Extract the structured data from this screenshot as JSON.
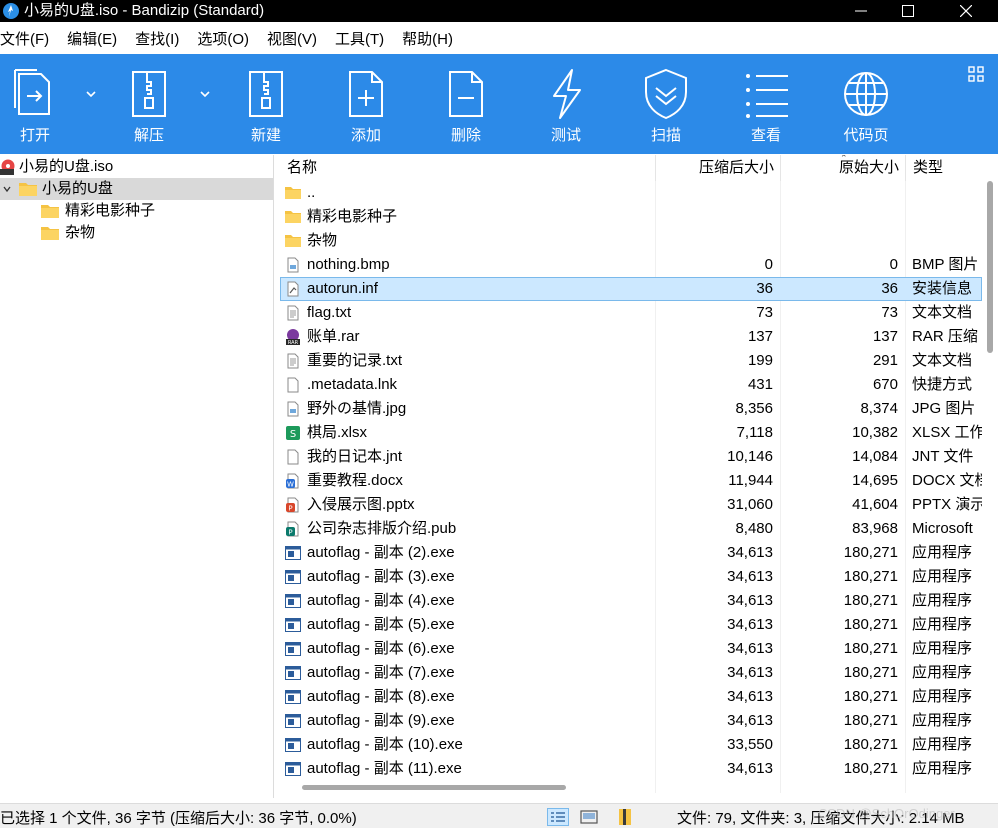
{
  "window": {
    "title": "小易的U盘.iso - Bandizip (Standard)",
    "accent": "#2c8ae8"
  },
  "menu": [
    "文件(F)",
    "编辑(E)",
    "查找(I)",
    "选项(O)",
    "视图(V)",
    "工具(T)",
    "帮助(H)"
  ],
  "toolbar": [
    {
      "label": "打开",
      "icon": "open-icon"
    },
    {
      "label": "解压",
      "icon": "extract-icon"
    },
    {
      "label": "新建",
      "icon": "new-archive-icon"
    },
    {
      "label": "添加",
      "icon": "add-file-icon"
    },
    {
      "label": "删除",
      "icon": "delete-file-icon"
    },
    {
      "label": "测试",
      "icon": "test-lightning-icon"
    },
    {
      "label": "扫描",
      "icon": "scan-shield-icon"
    },
    {
      "label": "查看",
      "icon": "view-list-icon"
    },
    {
      "label": "代码页",
      "icon": "codepage-globe-icon"
    }
  ],
  "tree": {
    "root": "小易的U盘.iso",
    "folder": "小易的U盘",
    "children": [
      "精彩电影种子",
      "杂物"
    ]
  },
  "columns": {
    "name": "名称",
    "compressed": "压缩后大小",
    "original": "原始大小",
    "type": "类型"
  },
  "files": [
    {
      "name": "..",
      "comp": "",
      "orig": "",
      "type": "",
      "icon": "folder"
    },
    {
      "name": "精彩电影种子",
      "comp": "",
      "orig": "",
      "type": "",
      "icon": "folder"
    },
    {
      "name": "杂物",
      "comp": "",
      "orig": "",
      "type": "",
      "icon": "folder"
    },
    {
      "name": "nothing.bmp",
      "comp": "0",
      "orig": "0",
      "type": "BMP 图片",
      "icon": "image"
    },
    {
      "name": "autorun.inf",
      "comp": "36",
      "orig": "36",
      "type": "安装信息",
      "icon": "inf"
    },
    {
      "name": "flag.txt",
      "comp": "73",
      "orig": "73",
      "type": "文本文档",
      "icon": "text"
    },
    {
      "name": "账单.rar",
      "comp": "137",
      "orig": "137",
      "type": "RAR 压缩",
      "icon": "rar"
    },
    {
      "name": "重要的记录.txt",
      "comp": "199",
      "orig": "291",
      "type": "文本文档",
      "icon": "text"
    },
    {
      "name": ".metadata.lnk",
      "comp": "431",
      "orig": "670",
      "type": "快捷方式",
      "icon": "blank"
    },
    {
      "name": "野外の基情.jpg",
      "comp": "8,356",
      "orig": "8,374",
      "type": "JPG 图片",
      "icon": "image"
    },
    {
      "name": "棋局.xlsx",
      "comp": "7,118",
      "orig": "10,382",
      "type": "XLSX 工作",
      "icon": "xlsx"
    },
    {
      "name": "我的日记本.jnt",
      "comp": "10,146",
      "orig": "14,084",
      "type": "JNT 文件",
      "icon": "blank"
    },
    {
      "name": "重要教程.docx",
      "comp": "11,944",
      "orig": "14,695",
      "type": "DOCX 文档",
      "icon": "docx"
    },
    {
      "name": "入侵展示图.pptx",
      "comp": "31,060",
      "orig": "41,604",
      "type": "PPTX 演示",
      "icon": "pptx"
    },
    {
      "name": "公司杂志排版介绍.pub",
      "comp": "8,480",
      "orig": "83,968",
      "type": "Microsoft",
      "icon": "pub"
    },
    {
      "name": "autoflag - 副本 (2).exe",
      "comp": "34,613",
      "orig": "180,271",
      "type": "应用程序",
      "icon": "exe"
    },
    {
      "name": "autoflag - 副本 (3).exe",
      "comp": "34,613",
      "orig": "180,271",
      "type": "应用程序",
      "icon": "exe"
    },
    {
      "name": "autoflag - 副本 (4).exe",
      "comp": "34,613",
      "orig": "180,271",
      "type": "应用程序",
      "icon": "exe"
    },
    {
      "name": "autoflag - 副本 (5).exe",
      "comp": "34,613",
      "orig": "180,271",
      "type": "应用程序",
      "icon": "exe"
    },
    {
      "name": "autoflag - 副本 (6).exe",
      "comp": "34,613",
      "orig": "180,271",
      "type": "应用程序",
      "icon": "exe"
    },
    {
      "name": "autoflag - 副本 (7).exe",
      "comp": "34,613",
      "orig": "180,271",
      "type": "应用程序",
      "icon": "exe"
    },
    {
      "name": "autoflag - 副本 (8).exe",
      "comp": "34,613",
      "orig": "180,271",
      "type": "应用程序",
      "icon": "exe"
    },
    {
      "name": "autoflag - 副本 (9).exe",
      "comp": "34,613",
      "orig": "180,271",
      "type": "应用程序",
      "icon": "exe"
    },
    {
      "name": "autoflag - 副本 (10).exe",
      "comp": "33,550",
      "orig": "180,271",
      "type": "应用程序",
      "icon": "exe"
    },
    {
      "name": "autoflag - 副本 (11).exe",
      "comp": "34,613",
      "orig": "180,271",
      "type": "应用程序",
      "icon": "exe"
    }
  ],
  "selected_row": 4,
  "status": {
    "left": "已选择 1 个文件, 36 字节 (压缩后大小: 36 字节, 0.0%)",
    "right": "文件: 79, 文件夹: 3, 压缩文件大小: 2.14 MB",
    "watermark": "CSDN @SchOrOdinger"
  }
}
